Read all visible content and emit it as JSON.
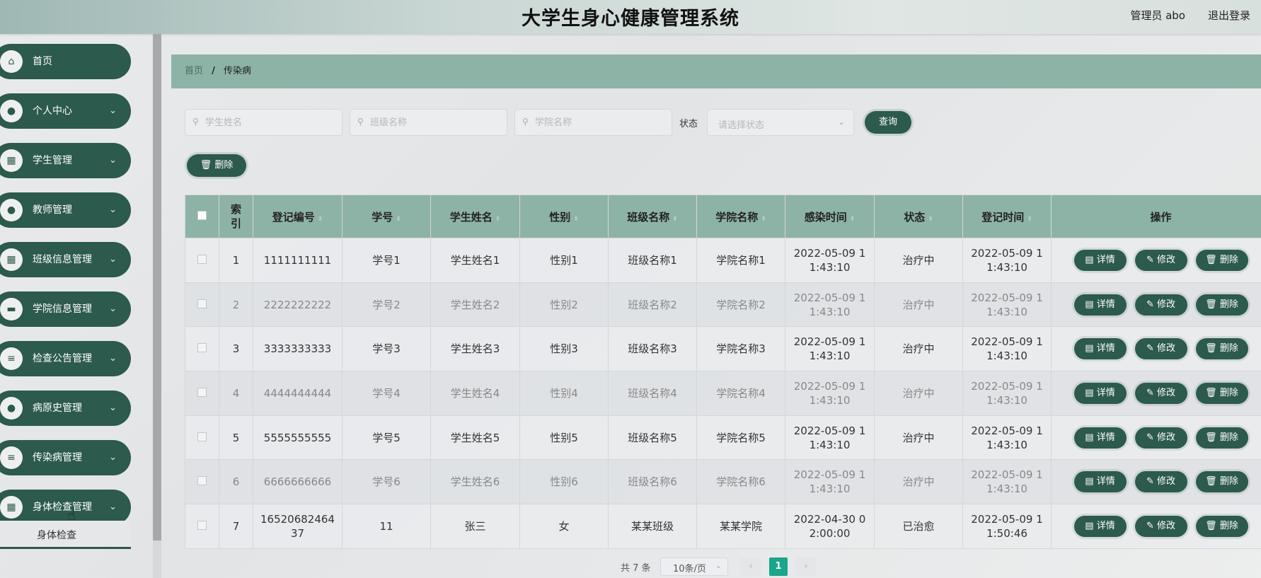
{
  "header": {
    "title": "大学生身心健康管理系统",
    "user": "管理员 abo",
    "logout": "退出登录"
  },
  "sidebar": {
    "items": [
      {
        "label": "首页",
        "icon": "home-icon",
        "glyph": "⌂",
        "has_children": false
      },
      {
        "label": "个人中心",
        "icon": "user-icon",
        "glyph": "●",
        "has_children": true
      },
      {
        "label": "学生管理",
        "icon": "grid-icon",
        "glyph": "▦",
        "has_children": true
      },
      {
        "label": "教师管理",
        "icon": "location-icon",
        "glyph": "●",
        "has_children": true
      },
      {
        "label": "班级信息管理",
        "icon": "grid-icon",
        "glyph": "▦",
        "has_children": true
      },
      {
        "label": "学院信息管理",
        "icon": "briefcase-icon",
        "glyph": "▬",
        "has_children": true
      },
      {
        "label": "检查公告管理",
        "icon": "sliders-icon",
        "glyph": "≡",
        "has_children": true
      },
      {
        "label": "病原史管理",
        "icon": "user-icon",
        "glyph": "●",
        "has_children": true
      },
      {
        "label": "传染病管理",
        "icon": "list-icon",
        "glyph": "≡",
        "has_children": true
      },
      {
        "label": "身体检查管理",
        "icon": "grid-icon",
        "glyph": "▦",
        "has_children": true
      }
    ],
    "submenu": "身体检查",
    "chevron": "⌄"
  },
  "breadcrumb": {
    "home": "首页",
    "separator": "/",
    "current": "传染病"
  },
  "search": {
    "student_name_placeholder": "学生姓名",
    "class_name_placeholder": "班级名称",
    "college_name_placeholder": "学院名称",
    "status_label": "状态",
    "status_placeholder": "请选择状态",
    "query": "查询"
  },
  "toolbar": {
    "delete": "删除"
  },
  "table": {
    "columns": [
      "索引",
      "登记编号",
      "学号",
      "学生姓名",
      "性别",
      "班级名称",
      "学院名称",
      "感染时间",
      "状态",
      "登记时间",
      "操作"
    ],
    "actions": {
      "detail": "详情",
      "edit": "修改",
      "delete": "删除"
    },
    "rows": [
      [
        "1",
        "1111111111",
        "学号1",
        "学生姓名1",
        "性别1",
        "班级名称1",
        "学院名称1",
        "2022-05-09 1\n1:43:10",
        "治疗中",
        "2022-05-09 1\n1:43:10"
      ],
      [
        "2",
        "2222222222",
        "学号2",
        "学生姓名2",
        "性别2",
        "班级名称2",
        "学院名称2",
        "2022-05-09 1\n1:43:10",
        "治疗中",
        "2022-05-09 1\n1:43:10"
      ],
      [
        "3",
        "3333333333",
        "学号3",
        "学生姓名3",
        "性别3",
        "班级名称3",
        "学院名称3",
        "2022-05-09 1\n1:43:10",
        "治疗中",
        "2022-05-09 1\n1:43:10"
      ],
      [
        "4",
        "4444444444",
        "学号4",
        "学生姓名4",
        "性别4",
        "班级名称4",
        "学院名称4",
        "2022-05-09 1\n1:43:10",
        "治疗中",
        "2022-05-09 1\n1:43:10"
      ],
      [
        "5",
        "5555555555",
        "学号5",
        "学生姓名5",
        "性别5",
        "班级名称5",
        "学院名称5",
        "2022-05-09 1\n1:43:10",
        "治疗中",
        "2022-05-09 1\n1:43:10"
      ],
      [
        "6",
        "6666666666",
        "学号6",
        "学生姓名6",
        "性别6",
        "班级名称6",
        "学院名称6",
        "2022-05-09 1\n1:43:10",
        "治疗中",
        "2022-05-09 1\n1:43:10"
      ],
      [
        "7",
        "16520682464\n37",
        "11",
        "张三",
        "女",
        "某某班级",
        "某某学院",
        "2022-04-30 0\n2:00:00",
        "已治愈",
        "2022-05-09 1\n1:50:46"
      ]
    ]
  },
  "pagination": {
    "total": "共 7 条",
    "page_size": "10条/页",
    "current_page": "1"
  },
  "colors": {
    "primary": "#2c5a4d",
    "accent": "#8db3a7",
    "page_active": "#1aa58c"
  }
}
